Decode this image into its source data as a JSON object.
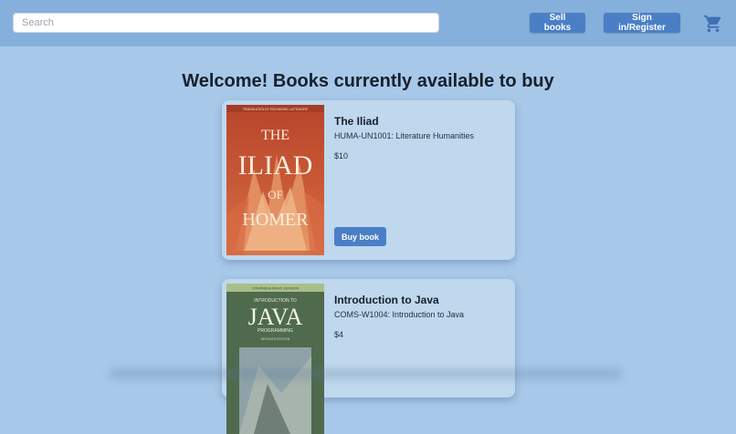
{
  "search": {
    "placeholder": "Search"
  },
  "nav": {
    "sell_label": "Sell books",
    "sign_label": "Sign in/Register",
    "cart_icon": "cart-icon"
  },
  "page": {
    "heading": "Welcome! Books currently available to buy"
  },
  "books": [
    {
      "title": "The Iliad",
      "course": "HUMA-UN1001: Literature Humanities",
      "price": "$10",
      "buy_label": "Buy book",
      "cover": {
        "top_line": "TRANSLATED BY RICHMOND LATTIMORE",
        "title_lines": [
          "THE",
          "ILIAD",
          "OF",
          "HOMER"
        ]
      }
    },
    {
      "title": "Introduction to Java",
      "course": "COMS-W1004: Introduction to Java",
      "price": "$4",
      "cover": {
        "top_line": "COMPREHENSIVE VERSION",
        "title_lines": [
          "INTRODUCTION TO",
          "JAVA",
          "PROGRAMMING",
          "SEVENTH EDITION"
        ]
      }
    }
  ],
  "colors": {
    "accent": "#4a7fc6",
    "background": "#a7c8e8",
    "header": "#86b0dc",
    "card": "#bfd8ee"
  }
}
